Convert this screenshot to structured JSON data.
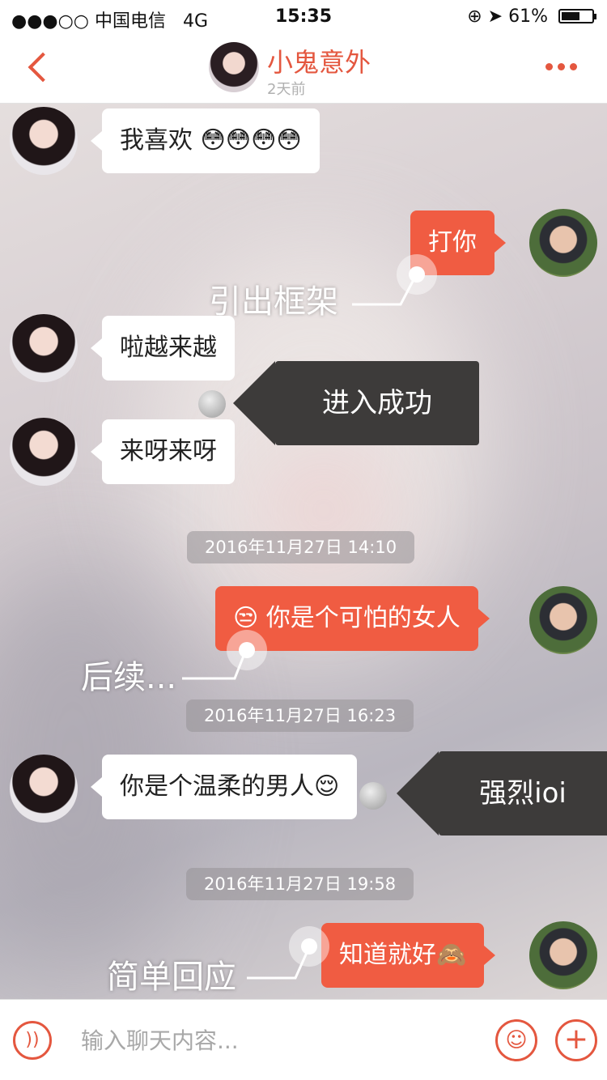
{
  "status_bar": {
    "carrier": "●●●○○ 中国电信",
    "network": "4G",
    "time": "15:35",
    "battery": "61%",
    "battery_level": 0.61
  },
  "header": {
    "title": "小鬼意外",
    "subtitle": "2天前"
  },
  "messages": [
    {
      "side": "in",
      "text": "我喜欢 😳😳😳😳"
    },
    {
      "side": "out",
      "text": "打你"
    },
    {
      "side": "in",
      "text": "啦越来越"
    },
    {
      "side": "in",
      "text": "来呀来呀"
    },
    {
      "side": "out",
      "text": "😒 你是个可怕的女人"
    },
    {
      "side": "in",
      "text": "你是个温柔的男人😌"
    },
    {
      "side": "out",
      "text": "知道就好🙈"
    }
  ],
  "timestamps": [
    "2016年11月27日 14:10",
    "2016年11月27日 16:23",
    "2016年11月27日 19:58"
  ],
  "annotations": {
    "label1": "引出框架",
    "label2": "后续...",
    "label3": "简单回应",
    "callout1": "进入成功",
    "callout2": "强烈ioi"
  },
  "input": {
    "placeholder": "输入聊天内容..."
  },
  "colors": {
    "accent": "#e4573f",
    "outgoing_bubble": "#f05c42",
    "callout": "#3d3b3a"
  },
  "icons": {
    "back": "chevron-left-icon",
    "more": "more-dots-icon",
    "voice": "voice-icon",
    "emoji": "emoji-icon",
    "plus": "plus-icon"
  }
}
